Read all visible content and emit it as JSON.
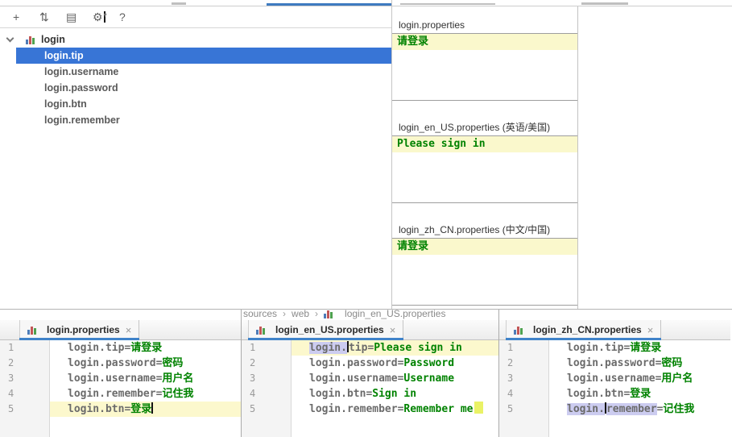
{
  "colors": {
    "selection_blue": "#3875D6",
    "value_green": "#008200",
    "key_gray": "#6B6B6B",
    "identifier_highlight": "#CCCCF0",
    "current_line_yellow": "#FCF8CD",
    "value_line_yellow": "#FAF8CC",
    "tab_underline_blue": "#4083C9"
  },
  "toolbar": {
    "add_icon": "+",
    "sort_icon": "⇅",
    "view_icon": "▤",
    "gear_icon": "⚙",
    "gear_caret": "▾",
    "help_icon": "?"
  },
  "tree": {
    "root_label": "login",
    "items": [
      {
        "label": "login.tip",
        "selected": true
      },
      {
        "label": "login.username",
        "selected": false
      },
      {
        "label": "login.password",
        "selected": false
      },
      {
        "label": "login.btn",
        "selected": false
      },
      {
        "label": "login.remember",
        "selected": false
      }
    ]
  },
  "values_panel": {
    "sections": [
      {
        "title": "login.properties",
        "value": "请登录"
      },
      {
        "title": "login_en_US.properties (英语/美国)",
        "value": "Please sign in"
      },
      {
        "title": "login_zh_CN.properties (中文/中国)",
        "value": "请登录"
      }
    ]
  },
  "breadcrumb": {
    "items": [
      "sources",
      "web",
      "login_en_US.properties"
    ],
    "separator": "›"
  },
  "syntax": {
    "equals": "="
  },
  "editors": [
    {
      "tab_label": "login.properties",
      "close_icon": "×",
      "lines": [
        {
          "num": "1",
          "key": "login.tip",
          "value": "请登录"
        },
        {
          "num": "2",
          "key": "login.password",
          "value": "密码"
        },
        {
          "num": "3",
          "key": "login.username",
          "value": "用户名"
        },
        {
          "num": "4",
          "key": "login.remember",
          "value": "记住我"
        },
        {
          "num": "5",
          "key": "login.btn",
          "value": "登录"
        }
      ]
    },
    {
      "tab_label": "login_en_US.properties",
      "close_icon": "×",
      "lines": [
        {
          "num": "1",
          "key_hl": "login.",
          "key_rest": "tip",
          "value": "Please sign in"
        },
        {
          "num": "2",
          "key": "login.password",
          "value": "Password"
        },
        {
          "num": "3",
          "key": "login.username",
          "value": "Username"
        },
        {
          "num": "4",
          "key": "login.btn",
          "value": "Sign in"
        },
        {
          "num": "5",
          "key": "login.remember",
          "value": "Remember me"
        }
      ]
    },
    {
      "tab_label": "login_zh_CN.properties",
      "close_icon": "×",
      "lines": [
        {
          "num": "1",
          "key": "login.tip",
          "value": "请登录"
        },
        {
          "num": "2",
          "key": "login.password",
          "value": "密码"
        },
        {
          "num": "3",
          "key": "login.username",
          "value": "用户名"
        },
        {
          "num": "4",
          "key": "login.btn",
          "value": "登录"
        },
        {
          "num": "5",
          "key_hl1": "login.",
          "key_hl2": "remember",
          "value": "记住我"
        }
      ]
    }
  ]
}
